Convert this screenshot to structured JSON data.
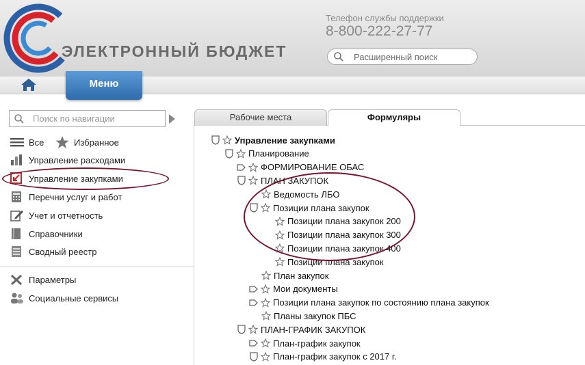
{
  "header": {
    "brand": "ЭЛЕКТРОННЫЙ БЮДЖЕТ",
    "support_label": "Телефон службы поддержки",
    "support_phone": "8-800-222-27-77",
    "search_placeholder": "Расширенный поиск"
  },
  "nav": {
    "menu_label": "Меню",
    "search_placeholder": "Поиск по навигации",
    "all_label": "Все",
    "favorites_label": "Избранное",
    "items": [
      {
        "label": "Управление расходами",
        "icon": "chart-icon"
      },
      {
        "label": "Управление закупками",
        "icon": "purchase-icon"
      },
      {
        "label": "Перечни услуг и работ",
        "icon": "calculator-icon"
      },
      {
        "label": "Учет и отчетность",
        "icon": "edit-icon"
      },
      {
        "label": "Справочники",
        "icon": "book-icon"
      },
      {
        "label": "Сводный реестр",
        "icon": "registry-icon"
      }
    ],
    "bottom_items": [
      {
        "label": "Параметры",
        "icon": "tools-icon"
      },
      {
        "label": "Социальные сервисы",
        "icon": "users-icon"
      }
    ]
  },
  "tabs": [
    {
      "label": "Рабочие места",
      "active": false
    },
    {
      "label": "Формуляры",
      "active": true
    }
  ],
  "tree": [
    {
      "label": "Управление закупками",
      "level": 0,
      "marker": "shield",
      "bold": true
    },
    {
      "label": "Планирование",
      "level": 1,
      "marker": "shield"
    },
    {
      "label": "ФОРМИРОВАНИЕ ОБАС",
      "level": 2,
      "marker": "arrow"
    },
    {
      "label": "ПЛАН ЗАКУПОК",
      "level": 2,
      "marker": "shield"
    },
    {
      "label": "Ведомость ЛБО",
      "level": 3,
      "marker": "none"
    },
    {
      "label": "Позиции плана закупок",
      "level": 3,
      "marker": "shield"
    },
    {
      "label": "Позиции плана закупок 200",
      "level": 4,
      "marker": "none"
    },
    {
      "label": "Позиции плана закупок 300",
      "level": 4,
      "marker": "none"
    },
    {
      "label": "Позиции плана закупок 400",
      "level": 4,
      "marker": "none"
    },
    {
      "label": "Позиции плана закупок",
      "level": 4,
      "marker": "none"
    },
    {
      "label": "План закупок",
      "level": 3,
      "marker": "none"
    },
    {
      "label": "Мои документы",
      "level": 3,
      "marker": "arrow"
    },
    {
      "label": "Позиции плана закупок по состоянию плана закупок",
      "level": 3,
      "marker": "arrow"
    },
    {
      "label": "Планы закупок ПБС",
      "level": 3,
      "marker": "none"
    },
    {
      "label": "ПЛАН-ГРАФИК ЗАКУПОК",
      "level": 2,
      "marker": "shield"
    },
    {
      "label": "План-график закупок",
      "level": 3,
      "marker": "arrow"
    },
    {
      "label": "План-график закупок с 2017 г.",
      "level": 3,
      "marker": "shield"
    }
  ],
  "colors": {
    "menu": "#3a7cc0",
    "highlight": "#7a1530"
  }
}
